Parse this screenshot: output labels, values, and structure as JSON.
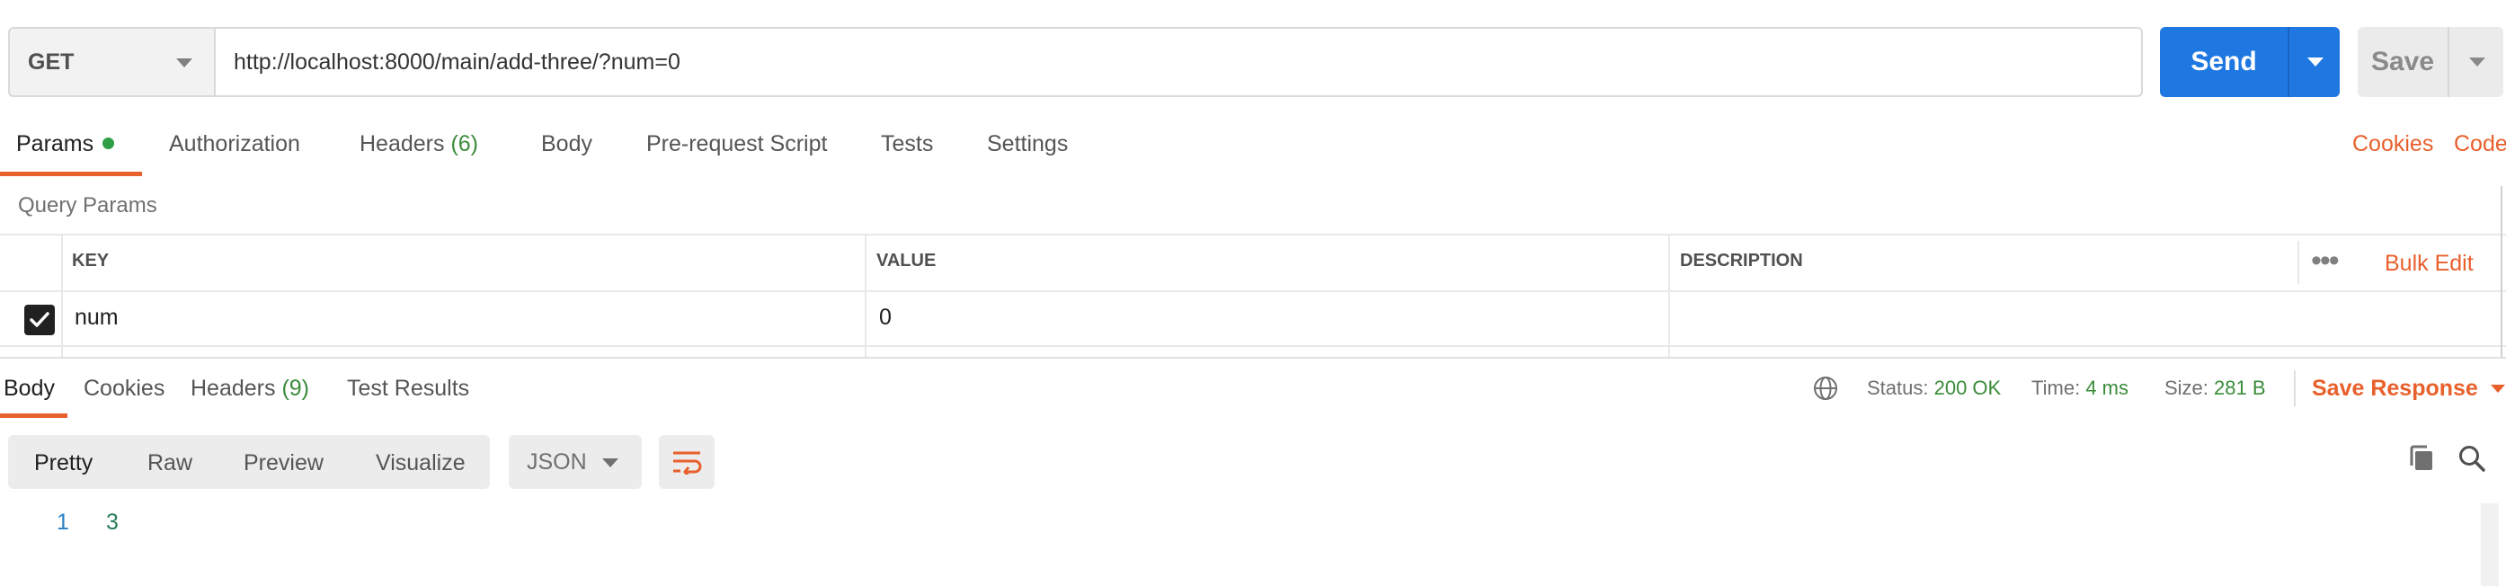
{
  "request": {
    "method": "GET",
    "url": "http://localhost:8000/main/add-three/?num=0",
    "send_label": "Send",
    "save_label": "Save"
  },
  "request_tabs": {
    "params": "Params",
    "authorization": "Authorization",
    "headers": "Headers",
    "headers_count": "(6)",
    "body": "Body",
    "prerequest": "Pre-request Script",
    "tests": "Tests",
    "settings": "Settings",
    "cookies_link": "Cookies",
    "code_link": "Code"
  },
  "query_params": {
    "title": "Query Params",
    "columns": {
      "key": "KEY",
      "value": "VALUE",
      "description": "DESCRIPTION"
    },
    "bulk_edit": "Bulk Edit",
    "rows": [
      {
        "key": "num",
        "value": "0",
        "description": "",
        "checked": true
      }
    ]
  },
  "response_tabs": {
    "body": "Body",
    "cookies": "Cookies",
    "headers": "Headers",
    "headers_count": "(9)",
    "test_results": "Test Results"
  },
  "response_status": {
    "status_label": "Status:",
    "status_value": "200 OK",
    "time_label": "Time:",
    "time_value": "4 ms",
    "size_label": "Size:",
    "size_value": "281 B",
    "save_response": "Save Response"
  },
  "format_bar": {
    "pretty": "Pretty",
    "raw": "Raw",
    "preview": "Preview",
    "visualize": "Visualize",
    "language": "JSON"
  },
  "response_body": {
    "line_number": "1",
    "content": "3"
  },
  "colors": {
    "accent": "#e8602c",
    "send": "#1f77e2",
    "success": "#3a8c3a"
  }
}
